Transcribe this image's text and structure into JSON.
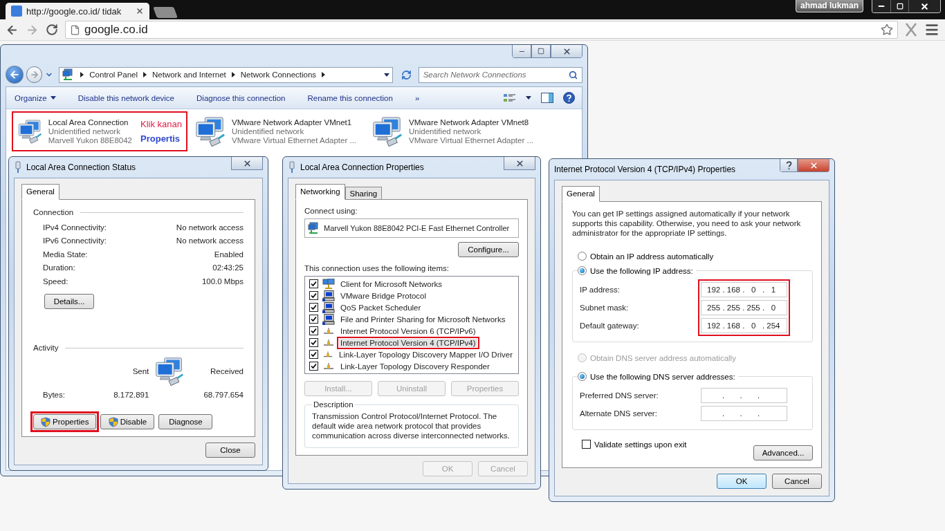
{
  "browser": {
    "tab": {
      "title": "http://google.co.id/ tidak",
      "selected": true
    },
    "user": "ahmad lukman",
    "address": "google.co.id"
  },
  "explorer": {
    "breadcrumb": [
      "Control Panel",
      "Network and Internet",
      "Network Connections"
    ],
    "search": {
      "placeholder": "Search Network Connections"
    },
    "toolbar": [
      {
        "label": "Organize",
        "kind": "menu"
      },
      {
        "label": "Disable this network device",
        "kind": "command"
      },
      {
        "label": "Diagnose this connection",
        "kind": "command"
      },
      {
        "label": "Rename this connection",
        "kind": "command"
      },
      {
        "label": "»",
        "kind": "more"
      }
    ],
    "connections": [
      {
        "name": "Local Area Connection",
        "status": "Unidentified network",
        "adapter": "Marvell Yukon 88E8042",
        "highlighted": true
      },
      {
        "name": "VMware Network Adapter VMnet1",
        "status": "Unidentified network",
        "adapter": "VMware Virtual Ethernet Adapter ...",
        "highlighted": false
      },
      {
        "name": "VMware Network Adapter VMnet8",
        "status": "Unidentified network",
        "adapter": "VMware Virtual Ethernet Adapter ...",
        "highlighted": false
      }
    ],
    "annotation": {
      "instruction": "Klik kanan",
      "action": "Propertis"
    }
  },
  "status_dialog": {
    "title": "Local Area Connection Status",
    "tabs": [
      {
        "label": "General",
        "selected": true
      }
    ],
    "connection": {
      "heading": "Connection",
      "rows": [
        {
          "label": "IPv4 Connectivity:",
          "value": "No network access"
        },
        {
          "label": "IPv6 Connectivity:",
          "value": "No network access"
        },
        {
          "label": "Media State:",
          "value": "Enabled"
        },
        {
          "label": "Duration:",
          "value": "02:43:25"
        },
        {
          "label": "Speed:",
          "value": "100.0 Mbps"
        }
      ]
    },
    "details_button": "Details...",
    "activity": {
      "heading": "Activity",
      "sent_label": "Sent",
      "received_label": "Received",
      "bytes_label": "Bytes:",
      "sent": "8.172.891",
      "received": "68.797.654"
    },
    "buttons": [
      {
        "label": "Properties",
        "shield": true,
        "highlighted": true
      },
      {
        "label": "Disable",
        "shield": true,
        "highlighted": false
      },
      {
        "label": "Diagnose",
        "shield": false,
        "highlighted": false
      }
    ],
    "close_button": "Close"
  },
  "properties_dialog": {
    "title": "Local Area Connection Properties",
    "tabs": [
      {
        "label": "Networking",
        "selected": true
      },
      {
        "label": "Sharing",
        "selected": false
      }
    ],
    "connect_using_label": "Connect using:",
    "adapter": "Marvell Yukon 88E8042 PCI-E Fast Ethernet Controller",
    "configure_button": "Configure...",
    "items_label": "This connection uses the following items:",
    "items": [
      {
        "label": "Client for Microsoft Networks",
        "kind": "client",
        "checked": true,
        "selected": false,
        "highlighted": false
      },
      {
        "label": "VMware Bridge Protocol",
        "kind": "service",
        "checked": true,
        "selected": false,
        "highlighted": false
      },
      {
        "label": "QoS Packet Scheduler",
        "kind": "service",
        "checked": true,
        "selected": false,
        "highlighted": false
      },
      {
        "label": "File and Printer Sharing for Microsoft Networks",
        "kind": "service",
        "checked": true,
        "selected": false,
        "highlighted": false
      },
      {
        "label": "Internet Protocol Version 6 (TCP/IPv6)",
        "kind": "protocol",
        "checked": true,
        "selected": false,
        "highlighted": false
      },
      {
        "label": "Internet Protocol Version 4 (TCP/IPv4)",
        "kind": "protocol",
        "checked": true,
        "selected": true,
        "highlighted": true
      },
      {
        "label": "Link-Layer Topology Discovery Mapper I/O Driver",
        "kind": "protocol",
        "checked": true,
        "selected": false,
        "highlighted": false
      },
      {
        "label": "Link-Layer Topology Discovery Responder",
        "kind": "protocol",
        "checked": true,
        "selected": false,
        "highlighted": false
      }
    ],
    "item_buttons": [
      {
        "label": "Install...",
        "disabled": true
      },
      {
        "label": "Uninstall",
        "disabled": true
      },
      {
        "label": "Properties",
        "disabled": true
      }
    ],
    "description": {
      "heading": "Description",
      "text": "Transmission Control Protocol/Internet Protocol. The default wide area network protocol that provides communication across diverse interconnected networks."
    },
    "footer_buttons": [
      {
        "label": "OK",
        "disabled": true
      },
      {
        "label": "Cancel",
        "disabled": true
      }
    ]
  },
  "ipv4_dialog": {
    "title": "Internet Protocol Version 4 (TCP/IPv4) Properties",
    "tabs": [
      {
        "label": "General",
        "selected": true
      }
    ],
    "intro": "You can get IP settings assigned automatically if your network supports this capability. Otherwise, you need to ask your network administrator for the appropriate IP settings.",
    "ip_options": [
      {
        "label": "Obtain an IP address automatically",
        "selected": false,
        "disabled": false
      },
      {
        "label": "Use the following IP address:",
        "selected": true,
        "disabled": false
      }
    ],
    "ip_fields_highlighted": true,
    "ip_fields": [
      {
        "label": "IP address:",
        "value": "192 . 168 .   0   .   1"
      },
      {
        "label": "Subnet mask:",
        "value": "255 . 255 . 255 .   0"
      },
      {
        "label": "Default gateway:",
        "value": "192 . 168 .   0   . 254"
      }
    ],
    "dns_options": [
      {
        "label": "Obtain DNS server address automatically",
        "selected": false,
        "disabled": true
      },
      {
        "label": "Use the following DNS server addresses:",
        "selected": true,
        "disabled": false
      }
    ],
    "dns_fields": [
      {
        "label": "Preferred DNS server:",
        "value": ".       .       ."
      },
      {
        "label": "Alternate DNS server:",
        "value": ".       .       ."
      }
    ],
    "validate": {
      "label": "Validate settings upon exit",
      "checked": false
    },
    "advanced_button": "Advanced...",
    "buttons": [
      {
        "label": "OK",
        "default": true
      },
      {
        "label": "Cancel",
        "default": false
      }
    ]
  }
}
